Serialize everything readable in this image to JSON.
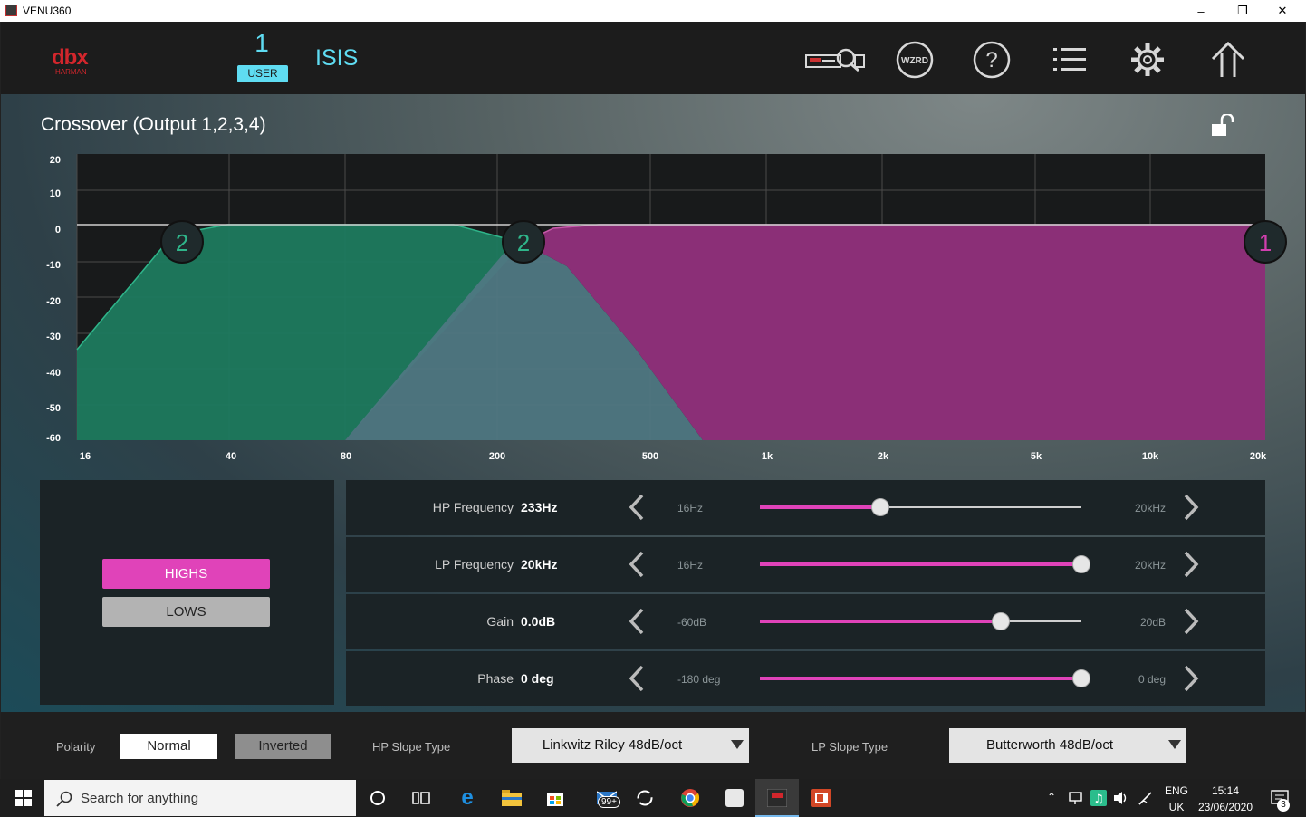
{
  "window": {
    "title": "VENU360",
    "minimize": "–",
    "maximize": "❐",
    "close": "✕"
  },
  "header": {
    "logo": "dbx",
    "logo_sub": "HARMAN",
    "preset_number": "1",
    "preset_badge": "USER",
    "preset_name": "ISIS",
    "icons": [
      "device-scan-icon",
      "wizard-icon",
      "help-icon",
      "menu-list-icon",
      "settings-gear-icon",
      "home-up-icon"
    ],
    "wizard_label": "WZRD",
    "help_label": "?"
  },
  "page": {
    "title": "Crossover  (Output 1,2,3,4)"
  },
  "graph": {
    "y_ticks": [
      "20",
      "10",
      "0",
      "-10",
      "-20",
      "-30",
      "-40",
      "-50",
      "-60"
    ],
    "x_ticks": [
      "16",
      "40",
      "80",
      "200",
      "500",
      "1k",
      "2k",
      "5k",
      "10k",
      "20k"
    ],
    "markers": [
      {
        "label": "2",
        "color": "#2fb58a"
      },
      {
        "label": "2",
        "color": "#2fb58a"
      },
      {
        "label": "1",
        "color": "#d03fae"
      }
    ]
  },
  "bands": {
    "highs": "HIGHS",
    "lows": "LOWS",
    "selected": "HIGHS"
  },
  "params": [
    {
      "label": "HP Frequency",
      "value": "233Hz",
      "min": "16Hz",
      "max": "20kHz",
      "level": 0.375
    },
    {
      "label": "LP Frequency",
      "value": "20kHz",
      "min": "16Hz",
      "max": "20kHz",
      "level": 1.0
    },
    {
      "label": "Gain",
      "value": "0.0dB",
      "min": "-60dB",
      "max": "20dB",
      "level": 0.75
    },
    {
      "label": "Phase",
      "value": "0 deg",
      "min": "-180 deg",
      "max": "0 deg",
      "level": 1.0
    }
  ],
  "bottom": {
    "polarity_label": "Polarity",
    "polarity_normal": "Normal",
    "polarity_inverted": "Inverted",
    "hp_slope_label": "HP Slope Type",
    "hp_slope_value": "Linkwitz Riley 48dB/oct",
    "lp_slope_label": "LP Slope Type",
    "lp_slope_value": "Butterworth 48dB/oct"
  },
  "taskbar": {
    "search_placeholder": "Search for anything",
    "mail_badge": "99+",
    "lang_top": "ENG",
    "lang_bottom": "UK",
    "time": "15:14",
    "date": "23/06/2020",
    "notif_count": "3"
  },
  "colors": {
    "accent_cyan": "#5fdcf2",
    "accent_pink": "#e043b9",
    "low_band": "#1e7a5e",
    "high_band": "#8b2f77"
  }
}
